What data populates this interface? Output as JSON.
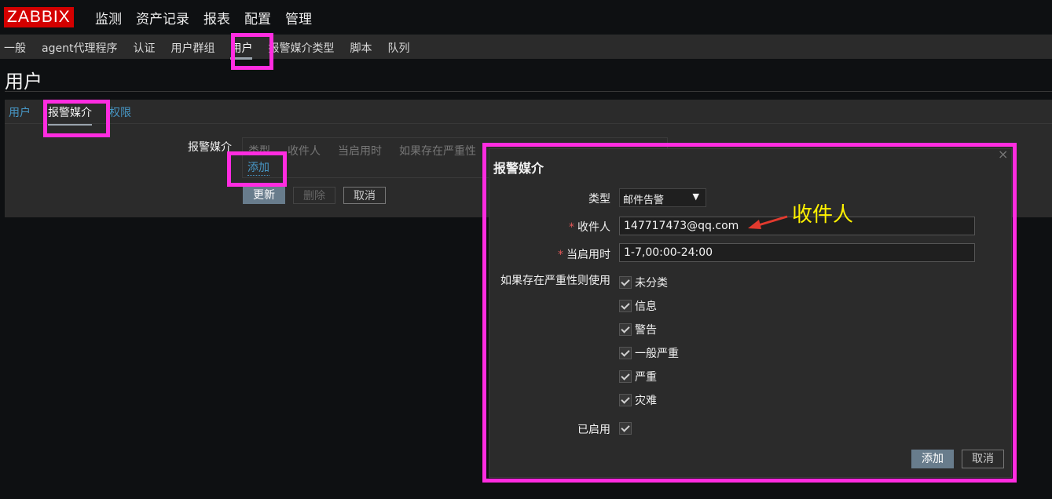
{
  "app": {
    "logo": "ZABBIX"
  },
  "main_menu": [
    "监测",
    "资产记录",
    "报表",
    "配置",
    "管理"
  ],
  "sub_menu": [
    "一般",
    "agent代理程序",
    "认证",
    "用户群组",
    "用户",
    "报警媒介类型",
    "脚本",
    "队列"
  ],
  "page_title": "用户",
  "tabs": [
    "用户",
    "报警媒介",
    "权限"
  ],
  "media_section": {
    "label": "报警媒介",
    "columns": [
      "类型",
      "收件人",
      "当启用时",
      "如果存在严重性"
    ],
    "add_link": "添加",
    "buttons": {
      "update": "更新",
      "delete": "删除",
      "cancel": "取消"
    }
  },
  "dialog": {
    "title": "报警媒介",
    "close": "×",
    "type": {
      "label": "类型",
      "value": "邮件告警",
      "arrow": "▼"
    },
    "recipient": {
      "required_mark": "*",
      "label": "收件人",
      "value": "147717473@qq.com"
    },
    "when_active": {
      "required_mark": "*",
      "label": "当启用时",
      "value": "1-7,00:00-24:00"
    },
    "severity": {
      "label": "如果存在严重性则使用",
      "items": [
        {
          "label": "未分类",
          "checked": true
        },
        {
          "label": "信息",
          "checked": true
        },
        {
          "label": "警告",
          "checked": true
        },
        {
          "label": "一般严重",
          "checked": true
        },
        {
          "label": "严重",
          "checked": true
        },
        {
          "label": "灾难",
          "checked": true
        }
      ]
    },
    "enabled": {
      "label": "已启用",
      "checked": true
    },
    "buttons": {
      "add": "添加",
      "cancel": "取消"
    }
  },
  "annotation": {
    "text": "收件人",
    "color": "#fff200"
  },
  "colors": {
    "highlight": "#ff2ce0",
    "link": "#4796c4",
    "logo_bg": "#d40000",
    "primary_button": "#687c8c",
    "required": "#e45959"
  }
}
